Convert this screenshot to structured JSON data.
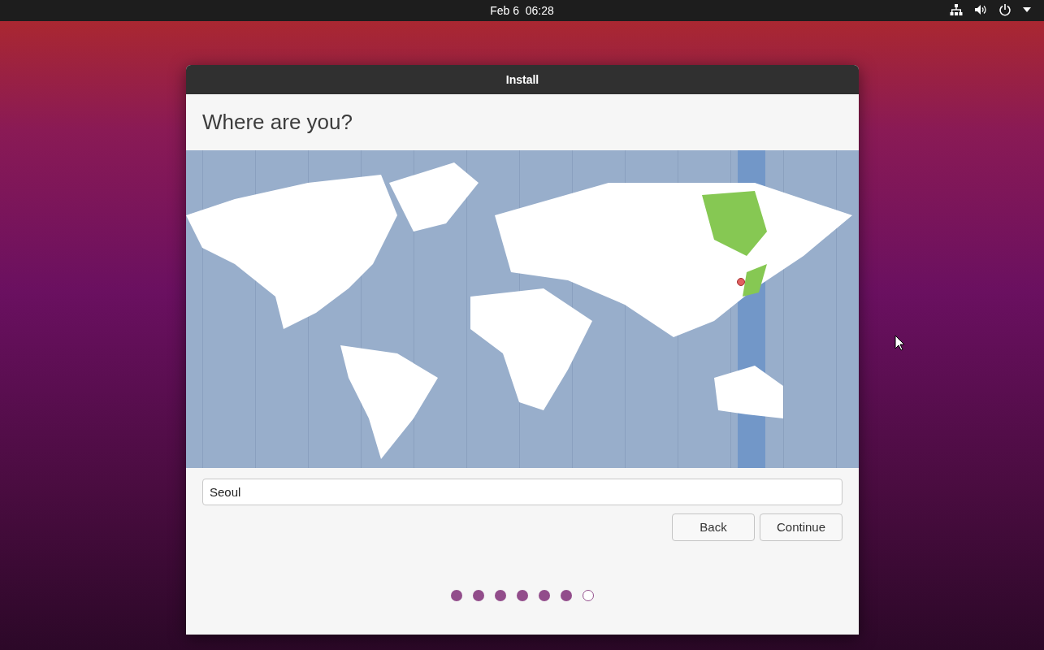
{
  "top_bar": {
    "clock": "Feb 6  06:28"
  },
  "window": {
    "title": "Install"
  },
  "heading": "Where are you?",
  "location_field": {
    "value": "Seoul"
  },
  "buttons": [
    "Back",
    "Continue"
  ],
  "steps": [
    {
      "done": true
    },
    {
      "done": true
    },
    {
      "done": true
    },
    {
      "done": true
    },
    {
      "done": true
    },
    {
      "done": true
    },
    {
      "done": false
    }
  ]
}
